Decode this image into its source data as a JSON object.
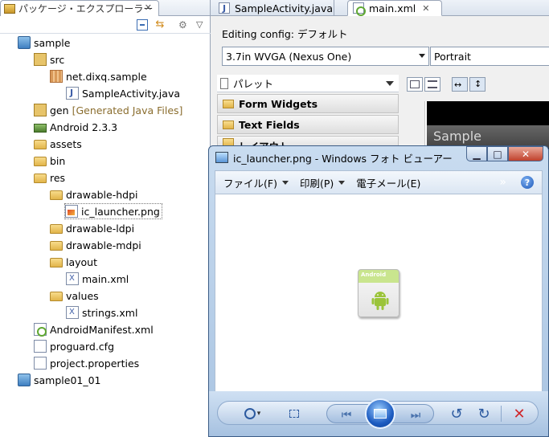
{
  "explorer": {
    "tab_title": "パッケージ・エクスプローラー",
    "tab_close": "✕",
    "tree": [
      {
        "label": "sample",
        "extra": "",
        "icon": "project-icon"
      },
      {
        "label": "src",
        "extra": "",
        "icon": "source-folder-icon"
      },
      {
        "label": "net.dixq.sample",
        "extra": "",
        "icon": "package-icon"
      },
      {
        "label": "SampleActivity.java",
        "extra": "",
        "icon": "java-file-icon"
      },
      {
        "label": "gen",
        "extra": "[Generated Java Files]",
        "icon": "source-folder-icon"
      },
      {
        "label": "Android 2.3.3",
        "extra": "",
        "icon": "library-icon"
      },
      {
        "label": "assets",
        "extra": "",
        "icon": "folder-icon"
      },
      {
        "label": "bin",
        "extra": "",
        "icon": "folder-icon"
      },
      {
        "label": "res",
        "extra": "",
        "icon": "folder-icon"
      },
      {
        "label": "drawable-hdpi",
        "extra": "",
        "icon": "folder-icon"
      },
      {
        "label": "ic_launcher.png",
        "extra": "",
        "icon": "image-file-icon"
      },
      {
        "label": "drawable-ldpi",
        "extra": "",
        "icon": "folder-icon"
      },
      {
        "label": "drawable-mdpi",
        "extra": "",
        "icon": "folder-icon"
      },
      {
        "label": "layout",
        "extra": "",
        "icon": "folder-icon"
      },
      {
        "label": "main.xml",
        "extra": "",
        "icon": "xml-file-icon"
      },
      {
        "label": "values",
        "extra": "",
        "icon": "folder-icon"
      },
      {
        "label": "strings.xml",
        "extra": "",
        "icon": "xml-file-icon"
      },
      {
        "label": "AndroidManifest.xml",
        "extra": "",
        "icon": "manifest-icon"
      },
      {
        "label": "proguard.cfg",
        "extra": "",
        "icon": "file-icon"
      },
      {
        "label": "project.properties",
        "extra": "",
        "icon": "file-icon"
      },
      {
        "label": "sample01_01",
        "extra": "",
        "icon": "project-icon"
      }
    ]
  },
  "editor": {
    "tabs": [
      {
        "label": "SampleActivity.java",
        "close": ""
      },
      {
        "label": "main.xml",
        "close": "✕"
      }
    ],
    "config_label": "Editing config: デフォルト",
    "device_select": "3.7in WVGA (Nexus One)",
    "orientation_select": "Portrait",
    "palette_title": "パレット",
    "palette_items": [
      "Form Widgets",
      "Text Fields",
      "レイアウト"
    ],
    "preview_title": "Sample"
  },
  "photo_viewer": {
    "title": "ic_launcher.png - Windows フォト ビューアー",
    "menu": [
      "ファイル(F)",
      "印刷(P)",
      "電子メール(E)"
    ],
    "more": "»",
    "help": "?",
    "image_label": "Android",
    "min_btn": "▁",
    "max_btn": "□",
    "close_btn": "✕"
  }
}
